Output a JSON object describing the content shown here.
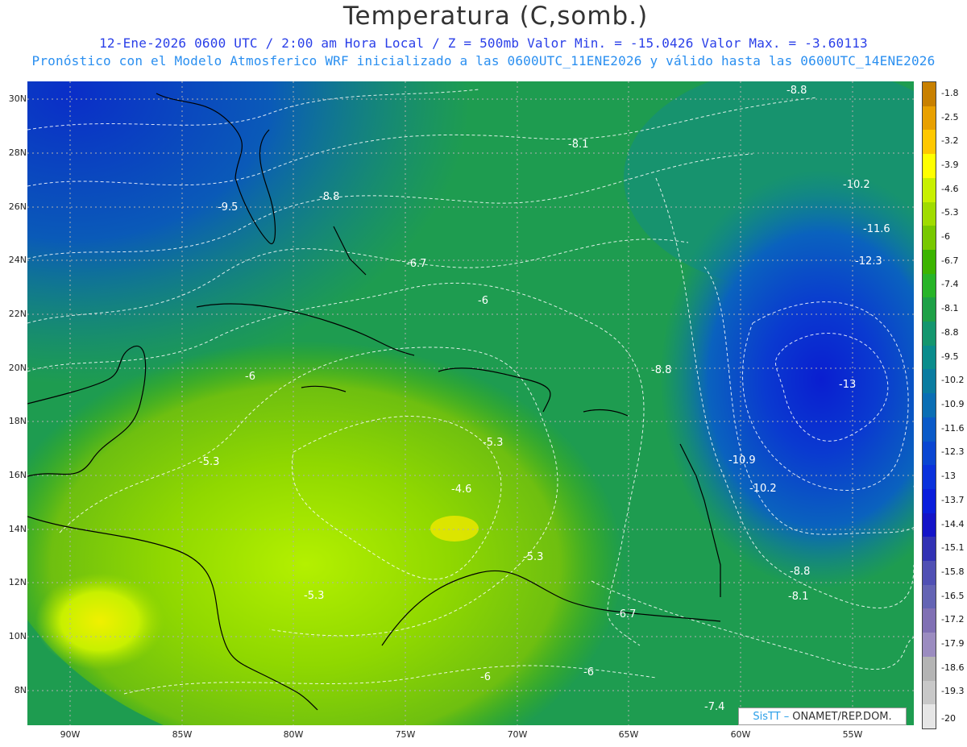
{
  "title": "Temperatura (C,somb.)",
  "subtitle1": "12-Ene-2026  0600 UTC / 2:00 am Hora Local / Z = 500mb  Valor Min. = -15.0426  Valor Max. = -3.60113",
  "subtitle2": "Pronóstico con el Modelo Atmosferico WRF inicializado a las 0600UTC_11ENE2026 y válido hasta las  0600UTC_14ENE2026",
  "credit": {
    "logo": "SisTT –",
    "text": "ONAMET/REP.DOM."
  },
  "map": {
    "variable": "Temperatura",
    "level": "500mb",
    "lat_labels": [
      "30N",
      "28N",
      "26N",
      "24N",
      "22N",
      "20N",
      "18N",
      "16N",
      "14N",
      "12N",
      "10N",
      "8N"
    ],
    "lon_labels": [
      "90W",
      "85W",
      "80W",
      "75W",
      "70W",
      "65W",
      "60W",
      "55W"
    ],
    "contour_labels": [
      {
        "text": "-8.8"
      },
      {
        "text": "-8.1"
      },
      {
        "text": "-10.2"
      },
      {
        "text": "-11.6"
      },
      {
        "text": "-12.3"
      },
      {
        "text": "-8.8"
      },
      {
        "text": "-9.5"
      },
      {
        "text": "-6.7"
      },
      {
        "text": "-6"
      },
      {
        "text": "-6"
      },
      {
        "text": "-8.8"
      },
      {
        "text": "-13"
      },
      {
        "text": "-5.3"
      },
      {
        "text": "-5.3"
      },
      {
        "text": "-10.9"
      },
      {
        "text": "-4.6"
      },
      {
        "text": "-10.2"
      },
      {
        "text": "-5.3"
      },
      {
        "text": "-5.3"
      },
      {
        "text": "-8.8"
      },
      {
        "text": "-6.7"
      },
      {
        "text": "-8.1"
      },
      {
        "text": "-6"
      },
      {
        "text": "-6"
      },
      {
        "text": "-7.4"
      }
    ]
  },
  "legend": {
    "labels": [
      "-1.8",
      "-2.5",
      "-3.2",
      "-3.9",
      "-4.6",
      "-5.3",
      "-6",
      "-6.7",
      "-7.4",
      "-8.1",
      "-8.8",
      "-9.5",
      "-10.2",
      "-10.9",
      "-11.6",
      "-12.3",
      "-13",
      "-13.7",
      "-14.4",
      "-15.1",
      "-15.8",
      "-16.5",
      "-17.2",
      "-17.9",
      "-18.6",
      "-19.3",
      "-20"
    ],
    "colors": [
      "#c88000",
      "#e8a000",
      "#ffc800",
      "#ffff00",
      "#c8f000",
      "#a0dc00",
      "#78c800",
      "#3cb400",
      "#28b428",
      "#1ea046",
      "#14966e",
      "#0a8c8c",
      "#0a7ca0",
      "#0a6eb4",
      "#0a5ac8",
      "#0a46d2",
      "#0a32dc",
      "#0a1edc",
      "#1414c8",
      "#3232b4",
      "#5050b4",
      "#6464b4",
      "#8070b4",
      "#9b8cc0",
      "#b4b4b4",
      "#c8c8c8",
      "#e6e6e6"
    ]
  },
  "colors": {
    "title": "#333333",
    "subtitle1": "#2a3fe8",
    "subtitle2": "#2a8ff0",
    "contour": "#ffffff",
    "coast": "#000000"
  }
}
